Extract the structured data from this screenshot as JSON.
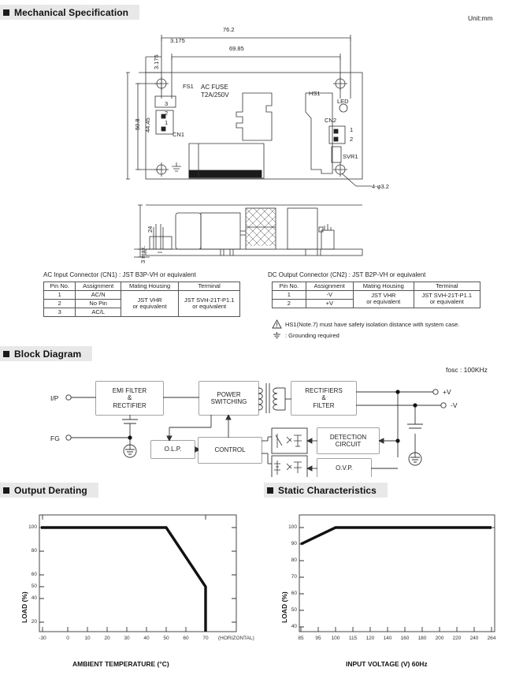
{
  "sections": {
    "mechanical": "Mechanical Specification",
    "block": "Block Diagram",
    "derating": "Output Derating",
    "static": "Static Characteristics"
  },
  "unit_note": "Unit:mm",
  "mechanical": {
    "dims": {
      "overall_width": "76.2",
      "inner_width": "69.85",
      "offset_left": "3.175",
      "offset_top": "3.175",
      "overall_height": "50.8",
      "inner_height": "44.45",
      "side_height": "24",
      "pin_height": "3 max.",
      "hole_callout": "4-φ3.2"
    },
    "parts": {
      "fs1": "FS1",
      "fuse_line1": "AC FUSE",
      "fuse_line2": "T2A/250V",
      "cn1": "CN1",
      "cn1_pins": [
        "3",
        "2",
        "1"
      ],
      "hs1": "HS1",
      "led": "LED",
      "cn2": "CN2",
      "cn2_pins": [
        "1",
        "2"
      ],
      "svr1": "SVR1"
    }
  },
  "ac_table": {
    "title": "AC Input Connector (CN1) : JST B3P-VH or equivalent",
    "headers": [
      "Pin No.",
      "Assignment",
      "Mating Housing",
      "Terminal"
    ],
    "rows": [
      [
        "1",
        "AC/N"
      ],
      [
        "2",
        "No Pin"
      ],
      [
        "3",
        "AC/L"
      ]
    ],
    "mating_housing": "JST VHR\nor equivalent",
    "mating_housing_l1": "JST VHR",
    "mating_housing_l2": "or equivalent",
    "terminal_l1": "JST SVH-21T-P1.1",
    "terminal_l2": "or equivalent"
  },
  "dc_table": {
    "title": "DC Output Connector (CN2) : JST B2P-VH or equivalent",
    "headers": [
      "Pin No.",
      "Assignment",
      "Mating Housing",
      "Terminal"
    ],
    "rows": [
      [
        "1",
        "-V"
      ],
      [
        "2",
        "+V"
      ]
    ],
    "mating_housing_l1": "JST VHR",
    "mating_housing_l2": "or equivalent",
    "terminal_l1": "JST SVH-21T-P1.1",
    "terminal_l2": "or equivalent"
  },
  "notes": {
    "warning": "HS1(Note.7) must have safety isolation distance with system case.",
    "grounding": ": Grounding required"
  },
  "block_diagram": {
    "fosc": "fosc : 100KHz",
    "input_label": "I/P",
    "fg_label": "FG",
    "out_pos": "+V",
    "out_neg": "-V",
    "boxes": {
      "emi": [
        "EMI FILTER",
        "&",
        "RECTIFIER"
      ],
      "power": [
        "POWER",
        "SWITCHING"
      ],
      "rect": [
        "RECTIFIERS",
        "&",
        "FILTER"
      ],
      "olp": [
        "O.L.P."
      ],
      "control": [
        "CONTROL"
      ],
      "detection": [
        "DETECTION",
        "CIRCUIT"
      ],
      "ovp": [
        "O.V.P."
      ]
    }
  },
  "chart_data": [
    {
      "type": "line",
      "title": "Output Derating",
      "xlabel": "AMBIENT TEMPERATURE (°C)",
      "ylabel": "LOAD (%)",
      "xlim": [
        -30,
        75
      ],
      "ylim": [
        0,
        112
      ],
      "xticks": [
        -30,
        0,
        10,
        20,
        30,
        40,
        50,
        60,
        70
      ],
      "xticklabels": [
        "-30",
        "0",
        "10",
        "20",
        "30",
        "40",
        "50",
        "60",
        "70"
      ],
      "yticks": [
        20,
        40,
        50,
        60,
        80,
        100
      ],
      "yticklabels": [
        "20",
        "40",
        "50",
        "60",
        "80",
        "100"
      ],
      "annotation": "(HORIZONTAL)",
      "grid": false,
      "series": [
        {
          "name": "derating",
          "x": [
            -30,
            50,
            70,
            70
          ],
          "y": [
            100,
            100,
            50,
            0
          ]
        }
      ]
    },
    {
      "type": "line",
      "title": "Static Characteristics",
      "xlabel": "INPUT VOLTAGE (V) 60Hz",
      "ylabel": "LOAD (%)",
      "xlim": [
        85,
        272
      ],
      "ylim": [
        32,
        108
      ],
      "xticks": [
        85,
        95,
        100,
        115,
        120,
        140,
        160,
        180,
        200,
        220,
        240,
        264
      ],
      "xticklabels": [
        "85",
        "95",
        "100",
        "115",
        "120",
        "140",
        "160",
        "180",
        "200",
        "220",
        "240",
        "264"
      ],
      "yticks": [
        40,
        50,
        60,
        70,
        80,
        90,
        100
      ],
      "yticklabels": [
        "40",
        "50",
        "60",
        "70",
        "80",
        "90",
        "100"
      ],
      "grid": false,
      "series": [
        {
          "name": "static",
          "x": [
            85,
            100,
            264
          ],
          "y": [
            90,
            100,
            100
          ]
        }
      ]
    }
  ]
}
